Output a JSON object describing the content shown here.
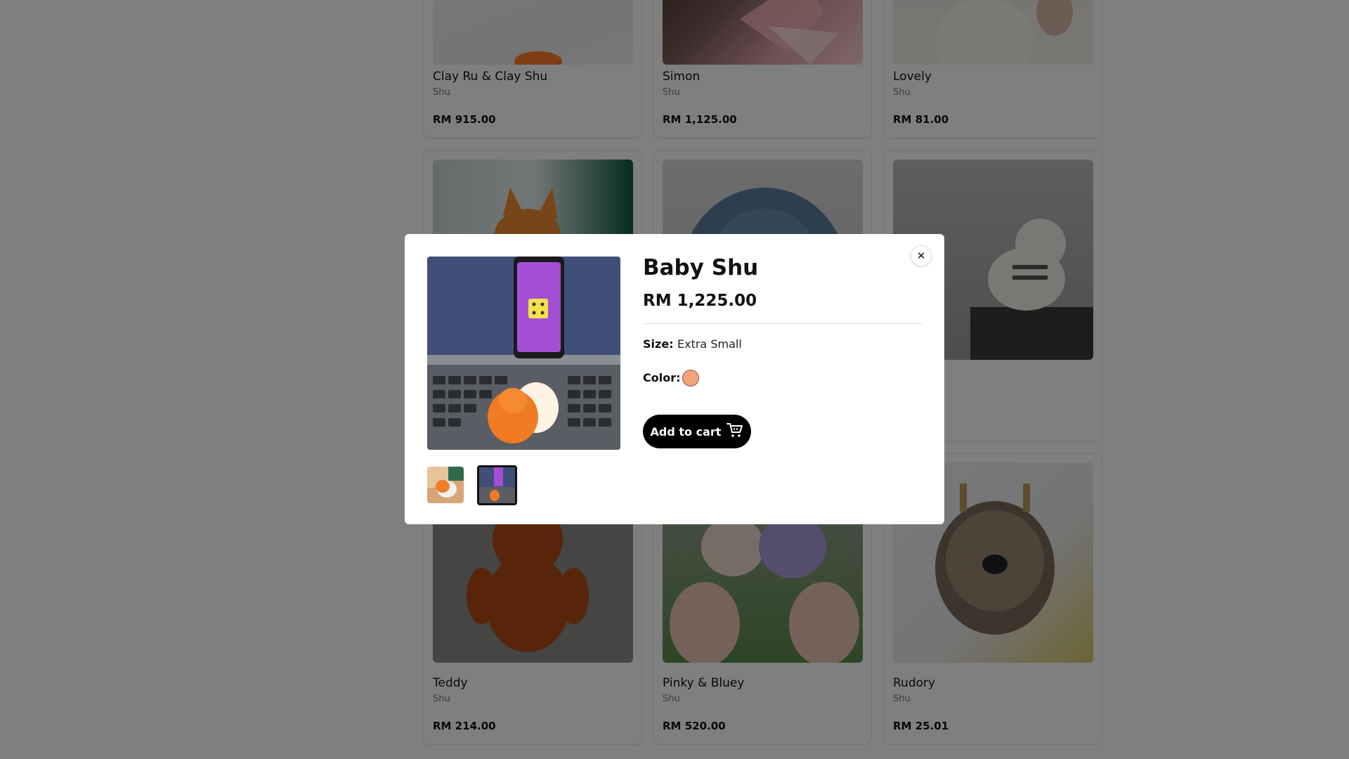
{
  "products": [
    {
      "name": "Clay Ru & Clay Shu",
      "brand": "Shu",
      "price": "RM 915.00"
    },
    {
      "name": "Simon",
      "brand": "Shu",
      "price": "RM 1,125.00"
    },
    {
      "name": "Lovely",
      "brand": "Shu",
      "price": "RM 81.00"
    },
    {
      "name": "",
      "brand": "",
      "price": ""
    },
    {
      "name": "",
      "brand": "",
      "price": ""
    },
    {
      "name": "",
      "brand": "",
      "price": ""
    },
    {
      "name": "Teddy",
      "brand": "Shu",
      "price": "RM 214.00"
    },
    {
      "name": "Pinky & Bluey",
      "brand": "Shu",
      "price": "RM 520.00"
    },
    {
      "name": "Rudory",
      "brand": "Shu",
      "price": "RM 25.01"
    }
  ],
  "modal": {
    "title": "Baby Shu",
    "price": "RM 1,225.00",
    "size_label": "Size:",
    "size_value": "Extra Small",
    "color_label": "Color:",
    "color_swatch": "#f3a27e",
    "add_to_cart_label": "Add to cart",
    "cart_icon": "cart-icon",
    "close_icon": "close-icon",
    "close_glyph": "✕",
    "selected_thumbnail": 2,
    "thumbnail_count": 2
  }
}
